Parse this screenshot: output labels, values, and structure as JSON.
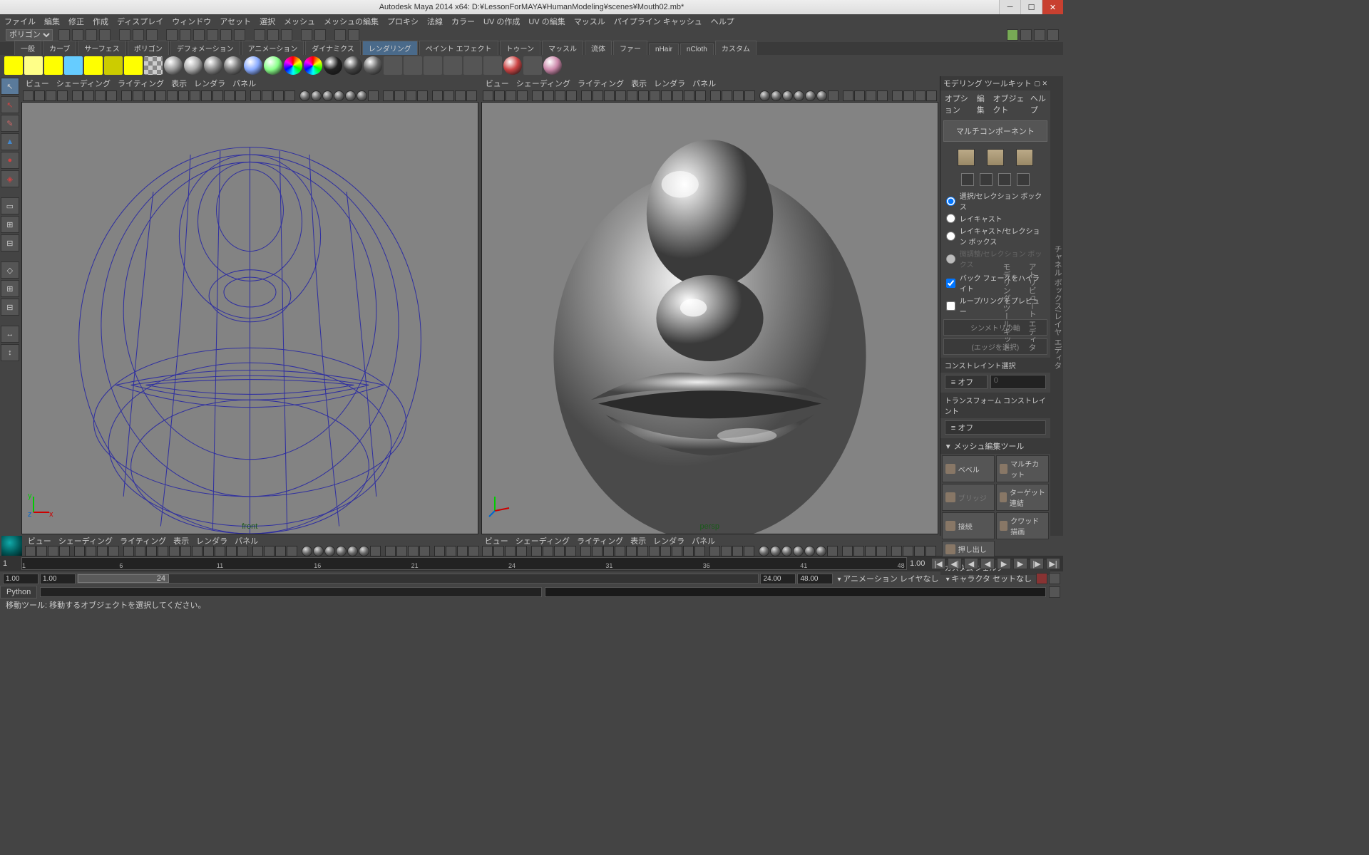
{
  "title": "Autodesk Maya 2014 x64: D:¥LessonForMAYA¥HumanModeling¥scenes¥Mouth02.mb*",
  "menu": [
    "ファイル",
    "編集",
    "修正",
    "作成",
    "ディスプレイ",
    "ウィンドウ",
    "アセット",
    "選択",
    "メッシュ",
    "メッシュの編集",
    "プロキシ",
    "法線",
    "カラー",
    "UV の作成",
    "UV の編集",
    "マッスル",
    "パイプライン キャッシュ",
    "ヘルプ"
  ],
  "mode": "ポリゴン",
  "shelfTabs": [
    "一般",
    "カーブ",
    "サーフェス",
    "ポリゴン",
    "デフォメーション",
    "アニメーション",
    "ダイナミクス",
    "レンダリング",
    "ペイント エフェクト",
    "トゥーン",
    "マッスル",
    "流体",
    "ファー",
    "nHair",
    "nCloth",
    "カスタム"
  ],
  "shelfActive": "レンダリング",
  "vpMenu": [
    "ビュー",
    "シェーディング",
    "ライティング",
    "表示",
    "レンダラ",
    "パネル"
  ],
  "vp1Label": "front",
  "vp2Label": "persp",
  "mk": {
    "title": "モデリング ツールキット",
    "menu": [
      "オプション",
      "編集",
      "オブジェクト",
      "ヘルプ"
    ],
    "multi": "マルチコンポーネント",
    "radios": [
      {
        "t": "選択/セレクション ボックス",
        "c": true,
        "d": false
      },
      {
        "t": "レイキャスト",
        "c": false,
        "d": false
      },
      {
        "t": "レイキャスト/セレクション ボックス",
        "c": false,
        "d": false
      },
      {
        "t": "微調整/セレクション ボックス",
        "c": false,
        "d": true
      }
    ],
    "checks": [
      {
        "t": "バック フェースをハイライト",
        "c": true
      },
      {
        "t": "ループ/リングをプレビュー",
        "c": false
      }
    ],
    "symBtn": "シンメトリの軸",
    "edgeSel": "(エッジを選択)",
    "constSel": "コンストレイント選択",
    "off": "オフ",
    "offNum": "0",
    "transConst": "トランスフォーム コンストレイント",
    "meshHdr": "メッシュ編集ツール",
    "mesh": [
      [
        "ベベル",
        "マルチカット"
      ],
      [
        "ブリッジ",
        "ターゲット連結"
      ],
      [
        "接続",
        "クワッド描画"
      ],
      [
        "押し出し",
        ""
      ]
    ],
    "custom": "カスタム シェルフ"
  },
  "sidetabs": [
    "チャネル ボックス/レイヤ エディタ",
    "アトリビュート エディタ",
    "モデリング ツールキット"
  ],
  "timeline": {
    "start": "1",
    "end": "1.00",
    "ticks": [
      "1",
      "6",
      "11",
      "16",
      "21",
      "24",
      "31",
      "36",
      "41",
      "48"
    ]
  },
  "range": {
    "a": "1.00",
    "b": "1.00",
    "handle": "24",
    "c": "24.00",
    "d": "48.00",
    "anim": "アニメーション レイヤなし",
    "char": "キャラクタ セットなし"
  },
  "cmd": {
    "lang": "Python"
  },
  "help": "移動ツール: 移動するオブジェクトを選択してください。"
}
